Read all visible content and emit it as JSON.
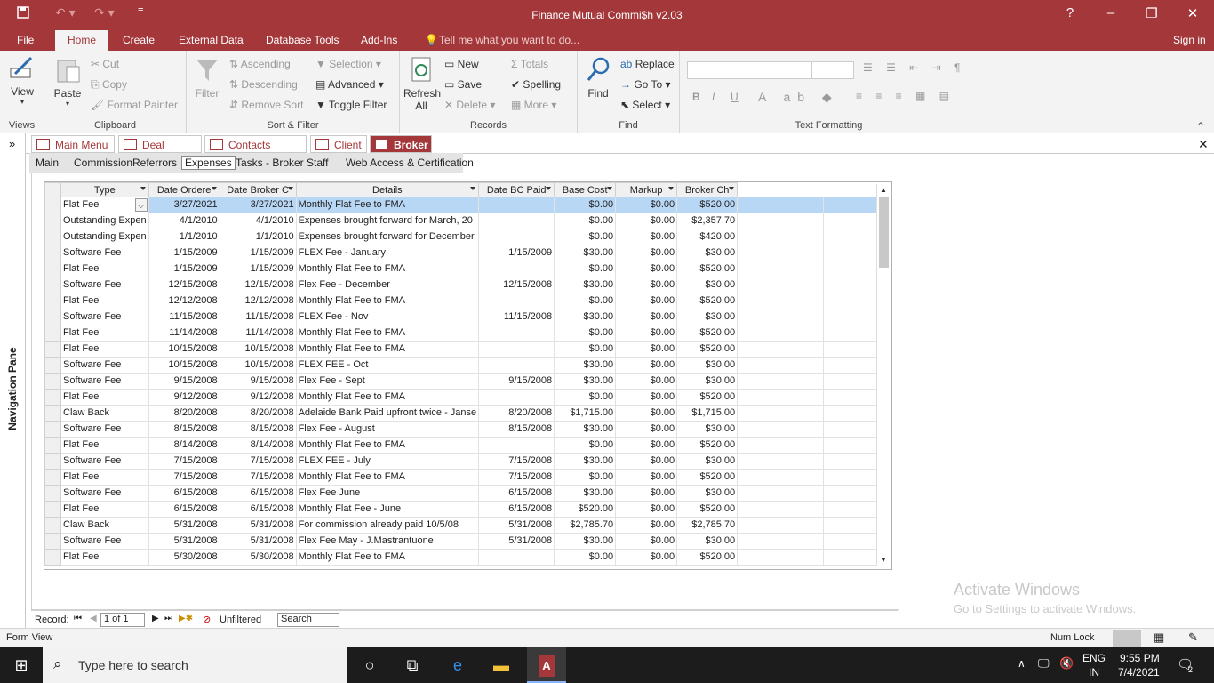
{
  "window": {
    "title": "Finance Mutual Commi$h v2.03",
    "help": "?",
    "minimize": "–",
    "restore": "❐",
    "close": "✕"
  },
  "ribbon_tabs": {
    "file": "File",
    "home": "Home",
    "create": "Create",
    "external": "External Data",
    "dbtools": "Database Tools",
    "addins": "Add-Ins",
    "tellme": "Tell me what you want to do...",
    "signin": "Sign in"
  },
  "ribbon": {
    "views": {
      "view": "View",
      "label": "Views"
    },
    "clipboard": {
      "paste": "Paste",
      "cut": "Cut",
      "copy": "Copy",
      "format_painter": "Format Painter",
      "label": "Clipboard"
    },
    "sort": {
      "filter": "Filter",
      "ascending": "Ascending",
      "descending": "Descending",
      "remove_sort": "Remove Sort",
      "selection": "Selection",
      "advanced": "Advanced",
      "toggle_filter": "Toggle Filter",
      "label": "Sort & Filter"
    },
    "records": {
      "refresh": "Refresh",
      "refresh2": "All",
      "new": "New",
      "save": "Save",
      "delete": "Delete",
      "totals": "Totals",
      "spelling": "Spelling",
      "more": "More",
      "label": "Records"
    },
    "find": {
      "find": "Find",
      "replace": "Replace",
      "goto": "Go To",
      "select": "Select",
      "label": "Find"
    },
    "text": {
      "label": "Text Formatting",
      "bold": "B",
      "italic": "I",
      "underline": "U"
    }
  },
  "nav_pane": {
    "label": "Navigation Pane"
  },
  "doc_tabs": [
    "Main Menu",
    "Deal Search",
    "Contacts Search",
    "Client",
    "Broker"
  ],
  "sub_tabs": [
    "Main",
    "Commission",
    "Referrors",
    "Expenses",
    "Tasks - Broker",
    "Staff",
    "Web Access & Certification"
  ],
  "grid": {
    "columns": [
      "Type",
      "Date Ordere",
      "Date Broker C",
      "Details",
      "Date BC Paid",
      "Base Cost",
      "Markup",
      "Broker Ch"
    ],
    "rows": [
      [
        "Flat Fee",
        "3/27/2021",
        "3/27/2021",
        "Monthly Flat Fee to FMA",
        "",
        "$0.00",
        "$0.00",
        "$520.00"
      ],
      [
        "Outstanding Expen",
        "4/1/2010",
        "4/1/2010",
        "Expenses brought forward for March, 20",
        "",
        "$0.00",
        "$0.00",
        "$2,357.70"
      ],
      [
        "Outstanding Expen",
        "1/1/2010",
        "1/1/2010",
        "Expenses brought forward for December",
        "",
        "$0.00",
        "$0.00",
        "$420.00"
      ],
      [
        "Software Fee",
        "1/15/2009",
        "1/15/2009",
        "FLEX Fee - January",
        "1/15/2009",
        "$30.00",
        "$0.00",
        "$30.00"
      ],
      [
        "Flat Fee",
        "1/15/2009",
        "1/15/2009",
        "Monthly Flat Fee to FMA",
        "",
        "$0.00",
        "$0.00",
        "$520.00"
      ],
      [
        "Software Fee",
        "12/15/2008",
        "12/15/2008",
        "Flex Fee - December",
        "12/15/2008",
        "$30.00",
        "$0.00",
        "$30.00"
      ],
      [
        "Flat Fee",
        "12/12/2008",
        "12/12/2008",
        "Monthly Flat Fee to FMA",
        "",
        "$0.00",
        "$0.00",
        "$520.00"
      ],
      [
        "Software Fee",
        "11/15/2008",
        "11/15/2008",
        "FLEX Fee - Nov",
        "11/15/2008",
        "$30.00",
        "$0.00",
        "$30.00"
      ],
      [
        "Flat Fee",
        "11/14/2008",
        "11/14/2008",
        "Monthly Flat Fee to FMA",
        "",
        "$0.00",
        "$0.00",
        "$520.00"
      ],
      [
        "Flat Fee",
        "10/15/2008",
        "10/15/2008",
        "Monthly Flat Fee to FMA",
        "",
        "$0.00",
        "$0.00",
        "$520.00"
      ],
      [
        "Software Fee",
        "10/15/2008",
        "10/15/2008",
        "FLEX FEE - Oct",
        "",
        "$30.00",
        "$0.00",
        "$30.00"
      ],
      [
        "Software Fee",
        "9/15/2008",
        "9/15/2008",
        "Flex Fee - Sept",
        "9/15/2008",
        "$30.00",
        "$0.00",
        "$30.00"
      ],
      [
        "Flat Fee",
        "9/12/2008",
        "9/12/2008",
        "Monthly Flat Fee to FMA",
        "",
        "$0.00",
        "$0.00",
        "$520.00"
      ],
      [
        "Claw Back",
        "8/20/2008",
        "8/20/2008",
        "Adelaide Bank Paid upfront twice - Janse",
        "8/20/2008",
        "$1,715.00",
        "$0.00",
        "$1,715.00"
      ],
      [
        "Software Fee",
        "8/15/2008",
        "8/15/2008",
        "Flex Fee - August",
        "8/15/2008",
        "$30.00",
        "$0.00",
        "$30.00"
      ],
      [
        "Flat Fee",
        "8/14/2008",
        "8/14/2008",
        "Monthly Flat Fee to FMA",
        "",
        "$0.00",
        "$0.00",
        "$520.00"
      ],
      [
        "Software Fee",
        "7/15/2008",
        "7/15/2008",
        "FLEX FEE - July",
        "7/15/2008",
        "$30.00",
        "$0.00",
        "$30.00"
      ],
      [
        "Flat Fee",
        "7/15/2008",
        "7/15/2008",
        "Monthly Flat Fee to FMA",
        "7/15/2008",
        "$0.00",
        "$0.00",
        "$520.00"
      ],
      [
        "Software Fee",
        "6/15/2008",
        "6/15/2008",
        "Flex Fee June",
        "6/15/2008",
        "$30.00",
        "$0.00",
        "$30.00"
      ],
      [
        "Flat Fee",
        "6/15/2008",
        "6/15/2008",
        "Monthly Flat Fee - June",
        "6/15/2008",
        "$520.00",
        "$0.00",
        "$520.00"
      ],
      [
        "Claw Back",
        "5/31/2008",
        "5/31/2008",
        "For commission already paid 10/5/08",
        "5/31/2008",
        "$2,785.70",
        "$0.00",
        "$2,785.70"
      ],
      [
        "Software Fee",
        "5/31/2008",
        "5/31/2008",
        "Flex Fee May - J.Mastrantuone",
        "5/31/2008",
        "$30.00",
        "$0.00",
        "$30.00"
      ],
      [
        "Flat Fee",
        "5/30/2008",
        "5/30/2008",
        "Monthly Flat Fee to FMA",
        "",
        "$0.00",
        "$0.00",
        "$520.00"
      ]
    ]
  },
  "watermark": {
    "line1": "Activate Windows",
    "line2": "Go to Settings to activate Windows."
  },
  "record_nav": {
    "label": "Record:",
    "position": "1 of 1",
    "filter": "Unfiltered",
    "search": "Search"
  },
  "status": {
    "left": "Form View",
    "numlock": "Num Lock"
  },
  "taskbar": {
    "search_placeholder": "Type here to search",
    "lang1": "ENG",
    "lang2": "IN",
    "time": "9:55 PM",
    "date": "7/4/2021",
    "notif": "2"
  }
}
